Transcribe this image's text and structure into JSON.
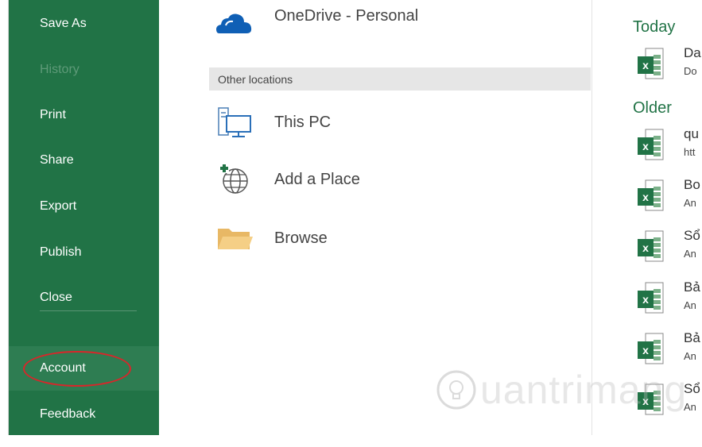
{
  "sidebar": {
    "items": [
      {
        "label": "Save As"
      },
      {
        "label": "History"
      },
      {
        "label": "Print"
      },
      {
        "label": "Share"
      },
      {
        "label": "Export"
      },
      {
        "label": "Publish"
      },
      {
        "label": "Close"
      },
      {
        "label": "Account"
      },
      {
        "label": "Feedback"
      }
    ]
  },
  "locations": {
    "onedrive_label": "OneDrive - Personal",
    "section_header": "Other locations",
    "items": [
      {
        "label": "This PC"
      },
      {
        "label": "Add a Place"
      },
      {
        "label": "Browse"
      }
    ]
  },
  "recent": {
    "today_label": "Today",
    "older_label": "Older",
    "files": [
      {
        "name": "Da",
        "path": "Do"
      },
      {
        "name": "qu",
        "path": "htt"
      },
      {
        "name": "Bo",
        "path": "An"
      },
      {
        "name": "Sổ",
        "path": "An"
      },
      {
        "name": "Bả",
        "path": "An"
      },
      {
        "name": "Bả",
        "path": "An"
      },
      {
        "name": "Sổ",
        "path": "An"
      }
    ]
  },
  "watermark": {
    "text": "uantrimang"
  },
  "colors": {
    "accent": "#217346",
    "annotation": "#d8262a"
  }
}
